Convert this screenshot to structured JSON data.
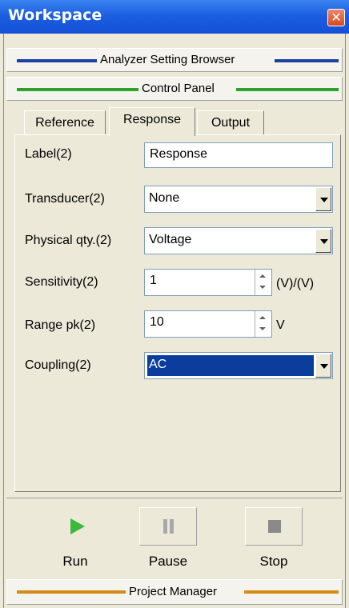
{
  "window": {
    "title": "Workspace",
    "close_glyph": "✕"
  },
  "sections": {
    "analyzer": "Analyzer Setting Browser",
    "control": "Control Panel",
    "project": "Project Manager"
  },
  "tabs": [
    {
      "label": "Reference",
      "active": false
    },
    {
      "label": "Response",
      "active": true
    },
    {
      "label": "Output",
      "active": false
    }
  ],
  "form": {
    "label": {
      "label": "Label(2)",
      "value": "Response"
    },
    "transducer": {
      "label": "Transducer(2)",
      "value": "None"
    },
    "physical": {
      "label": "Physical qty.(2)",
      "value": "Voltage"
    },
    "sensitivity": {
      "label": "Sensitivity(2)",
      "value": "1",
      "unit": "(V)/(V)"
    },
    "range": {
      "label": "Range pk(2)",
      "value": "10",
      "unit": "V"
    },
    "coupling": {
      "label": "Coupling(2)",
      "value": "AC"
    }
  },
  "controls": {
    "run": {
      "label": "Run",
      "icon": "play-icon"
    },
    "pause": {
      "label": "Pause",
      "icon": "pause-icon"
    },
    "stop": {
      "label": "Stop",
      "icon": "stop-icon"
    }
  },
  "colors": {
    "titlebar": "#1c5fe0",
    "analyzer_line": "#1d3fa0",
    "control_line": "#2ca12c",
    "project_line": "#d58a12",
    "selection": "#0a3d9c",
    "run_icon": "#3cb83c"
  }
}
